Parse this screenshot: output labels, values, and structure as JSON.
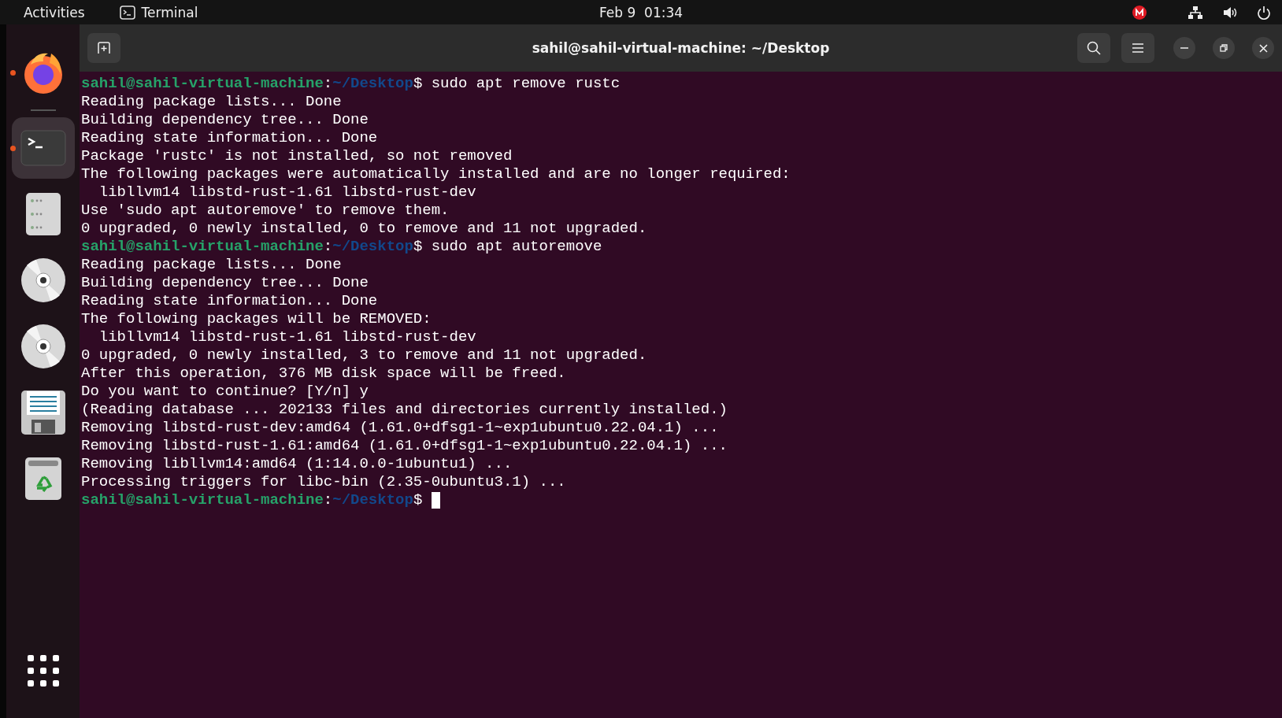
{
  "top_bar": {
    "activities": "Activities",
    "app_name": "Terminal",
    "clock": "Feb 9  01:34"
  },
  "dock": {
    "items": [
      {
        "kind": "browser",
        "running": true,
        "selected": false
      },
      {
        "kind": "terminal",
        "running": true,
        "selected": true
      },
      {
        "kind": "files",
        "running": false,
        "selected": false
      },
      {
        "kind": "disc",
        "running": false,
        "selected": false
      },
      {
        "kind": "disc",
        "running": false,
        "selected": false
      },
      {
        "kind": "save",
        "running": false,
        "selected": false
      },
      {
        "kind": "trash",
        "running": false,
        "selected": false
      }
    ]
  },
  "window": {
    "title": "sahil@sahil-virtual-machine: ~/Desktop"
  },
  "terminal": {
    "lines": [
      {
        "kind": "prompt",
        "user": "sahil@sahil-virtual-machine",
        "separator": ":",
        "path": "~/Desktop",
        "symbol": "$",
        "command": "sudo apt remove rustc",
        "cursor": false
      },
      {
        "kind": "output",
        "text": "Reading package lists... Done"
      },
      {
        "kind": "output",
        "text": "Building dependency tree... Done"
      },
      {
        "kind": "output",
        "text": "Reading state information... Done"
      },
      {
        "kind": "output",
        "text": "Package 'rustc' is not installed, so not removed"
      },
      {
        "kind": "output",
        "text": "The following packages were automatically installed and are no longer required:"
      },
      {
        "kind": "output",
        "text": "  libllvm14 libstd-rust-1.61 libstd-rust-dev"
      },
      {
        "kind": "output",
        "text": "Use 'sudo apt autoremove' to remove them."
      },
      {
        "kind": "output",
        "text": "0 upgraded, 0 newly installed, 0 to remove and 11 not upgraded."
      },
      {
        "kind": "prompt",
        "user": "sahil@sahil-virtual-machine",
        "separator": ":",
        "path": "~/Desktop",
        "symbol": "$",
        "command": "sudo apt autoremove",
        "cursor": false
      },
      {
        "kind": "output",
        "text": "Reading package lists... Done"
      },
      {
        "kind": "output",
        "text": "Building dependency tree... Done"
      },
      {
        "kind": "output",
        "text": "Reading state information... Done"
      },
      {
        "kind": "output",
        "text": "The following packages will be REMOVED:"
      },
      {
        "kind": "output",
        "text": "  libllvm14 libstd-rust-1.61 libstd-rust-dev"
      },
      {
        "kind": "output",
        "text": "0 upgraded, 0 newly installed, 3 to remove and 11 not upgraded."
      },
      {
        "kind": "output",
        "text": "After this operation, 376 MB disk space will be freed."
      },
      {
        "kind": "output",
        "text": "Do you want to continue? [Y/n] y"
      },
      {
        "kind": "output",
        "text": "(Reading database ... 202133 files and directories currently installed.)"
      },
      {
        "kind": "output",
        "text": "Removing libstd-rust-dev:amd64 (1.61.0+dfsg1-1~exp1ubuntu0.22.04.1) ..."
      },
      {
        "kind": "output",
        "text": "Removing libstd-rust-1.61:amd64 (1.61.0+dfsg1-1~exp1ubuntu0.22.04.1) ..."
      },
      {
        "kind": "output",
        "text": "Removing libllvm14:amd64 (1:14.0.0-1ubuntu1) ..."
      },
      {
        "kind": "output",
        "text": "Processing triggers for libc-bin (2.35-0ubuntu3.1) ..."
      },
      {
        "kind": "prompt",
        "user": "sahil@sahil-virtual-machine",
        "separator": ":",
        "path": "~/Desktop",
        "symbol": "$",
        "cursor": true
      }
    ]
  }
}
